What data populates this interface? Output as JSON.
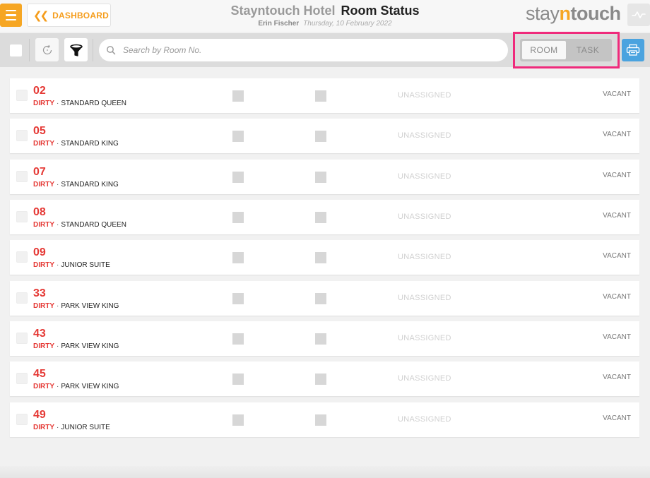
{
  "header": {
    "dashboard_label": "DASHBOARD",
    "hotel_name": "Stayntouch Hotel",
    "page_title": "Room Status",
    "user_name": "Erin Fischer",
    "date": "Thursday, 10 February 2022",
    "logo": {
      "part1": "stay",
      "part2": "n",
      "part3": "touch"
    }
  },
  "toolbar": {
    "search_placeholder": "Search by Room No.",
    "toggle": {
      "room_label": "ROOM",
      "task_label": "TASK",
      "active": "room"
    }
  },
  "colors": {
    "accent_orange": "#f6a623",
    "dirty_red": "#e53935",
    "highlight_pink": "#ef2a7b",
    "print_blue": "#4aa3df"
  },
  "icons": [
    "menu-icon",
    "double-chevron-left-icon",
    "pulse-icon",
    "refresh-icon",
    "filter-icon",
    "search-icon",
    "printer-icon"
  ],
  "rooms": [
    {
      "number": "02",
      "status": "DIRTY",
      "type": "STANDARD QUEEN",
      "assignment": "UNASSIGNED",
      "occupancy": "VACANT"
    },
    {
      "number": "05",
      "status": "DIRTY",
      "type": "STANDARD KING",
      "assignment": "UNASSIGNED",
      "occupancy": "VACANT"
    },
    {
      "number": "07",
      "status": "DIRTY",
      "type": "STANDARD KING",
      "assignment": "UNASSIGNED",
      "occupancy": "VACANT"
    },
    {
      "number": "08",
      "status": "DIRTY",
      "type": "STANDARD QUEEN",
      "assignment": "UNASSIGNED",
      "occupancy": "VACANT"
    },
    {
      "number": "09",
      "status": "DIRTY",
      "type": "JUNIOR SUITE",
      "assignment": "UNASSIGNED",
      "occupancy": "VACANT"
    },
    {
      "number": "33",
      "status": "DIRTY",
      "type": "PARK VIEW KING",
      "assignment": "UNASSIGNED",
      "occupancy": "VACANT"
    },
    {
      "number": "43",
      "status": "DIRTY",
      "type": "PARK VIEW KING",
      "assignment": "UNASSIGNED",
      "occupancy": "VACANT"
    },
    {
      "number": "45",
      "status": "DIRTY",
      "type": "PARK VIEW KING",
      "assignment": "UNASSIGNED",
      "occupancy": "VACANT"
    },
    {
      "number": "49",
      "status": "DIRTY",
      "type": "JUNIOR SUITE",
      "assignment": "UNASSIGNED",
      "occupancy": "VACANT"
    }
  ]
}
